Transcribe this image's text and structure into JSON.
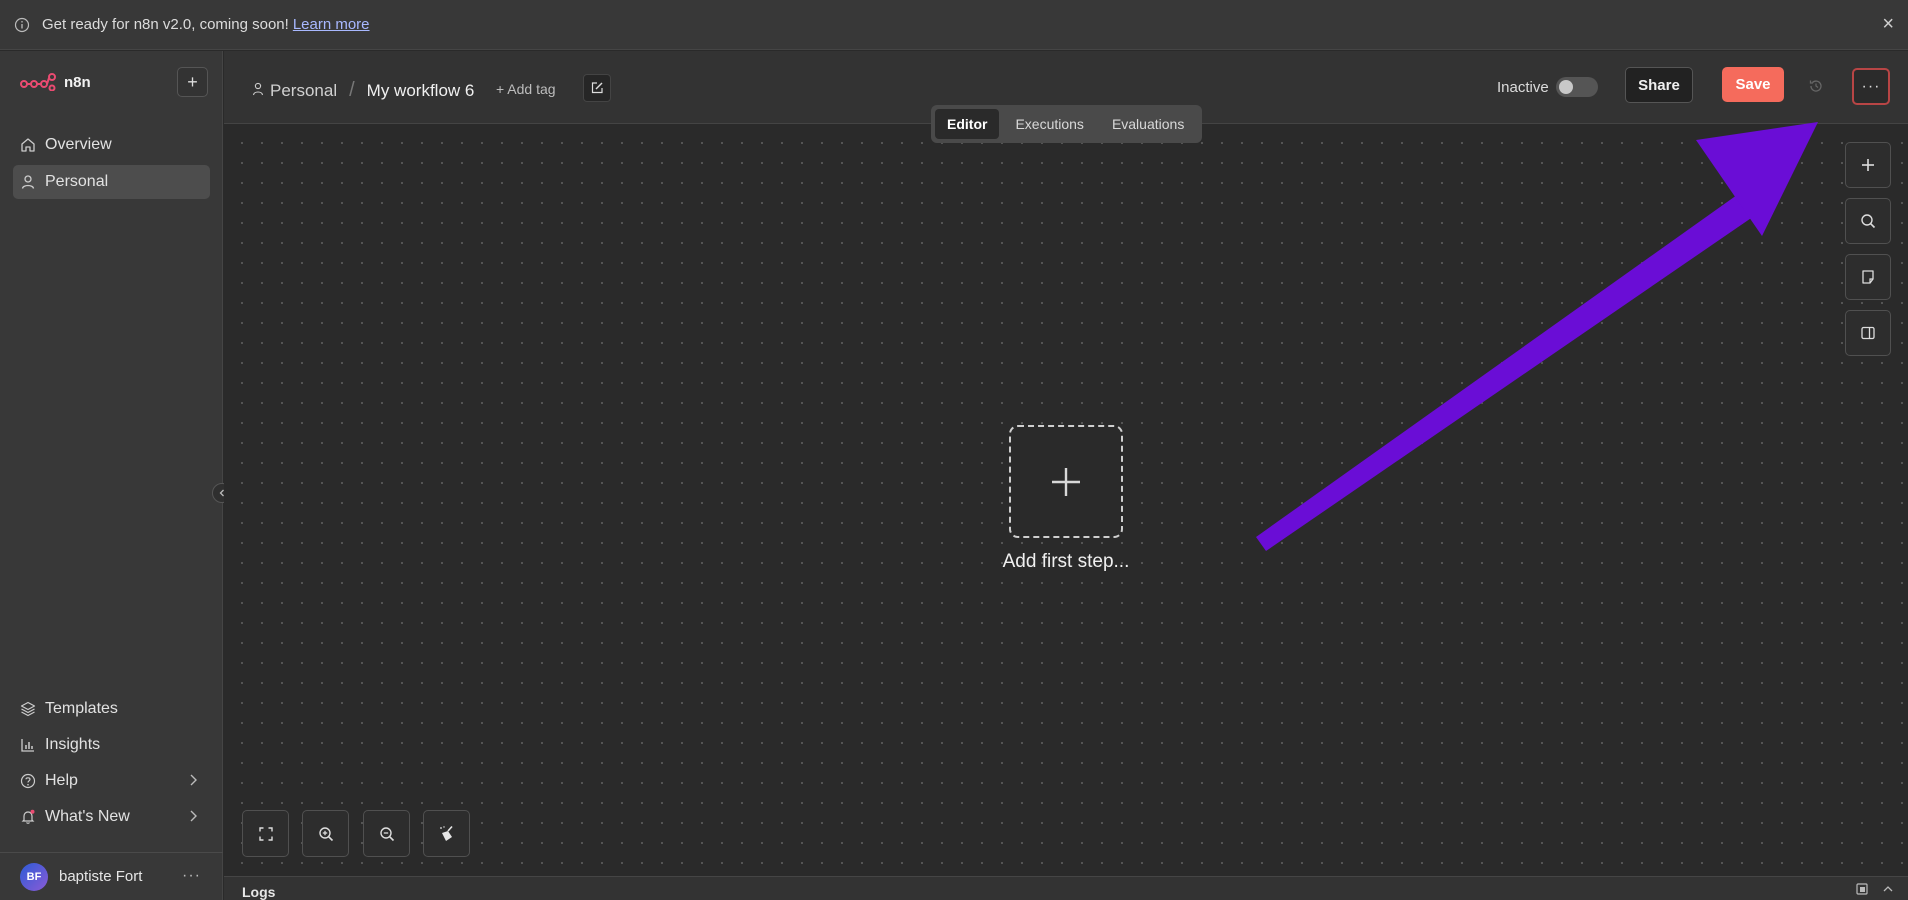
{
  "banner": {
    "message": "Get ready for n8n v2.0, coming soon!",
    "link": "Learn more",
    "close": "×"
  },
  "sidebar": {
    "logo_text": "n8n",
    "add_label": "+",
    "items": [
      {
        "label": "Overview",
        "icon": "home-icon",
        "active": false
      },
      {
        "label": "Personal",
        "icon": "user-icon",
        "active": true
      }
    ],
    "bottom_items": [
      {
        "label": "Templates",
        "icon": "templates-icon"
      },
      {
        "label": "Insights",
        "icon": "chart-icon"
      },
      {
        "label": "Help",
        "icon": "help-icon"
      },
      {
        "label": "What's New",
        "icon": "bell-icon"
      }
    ],
    "user": {
      "initials": "BF",
      "name": "baptiste Fort",
      "more": "···"
    }
  },
  "header": {
    "project": "Personal",
    "workflow_name": "My workflow 6",
    "add_tag": "+ Add tag",
    "status": "Inactive",
    "share": "Share",
    "save": "Save",
    "more": "···"
  },
  "tabs": [
    "Editor",
    "Executions",
    "Evaluations"
  ],
  "active_tab": "Editor",
  "canvas": {
    "first_step_label": "Add first step..."
  },
  "logs": {
    "label": "Logs"
  },
  "colors": {
    "save": "#f56b5c",
    "annotation_arrow": "#6a0dd6",
    "logo": "#ea4b71"
  }
}
